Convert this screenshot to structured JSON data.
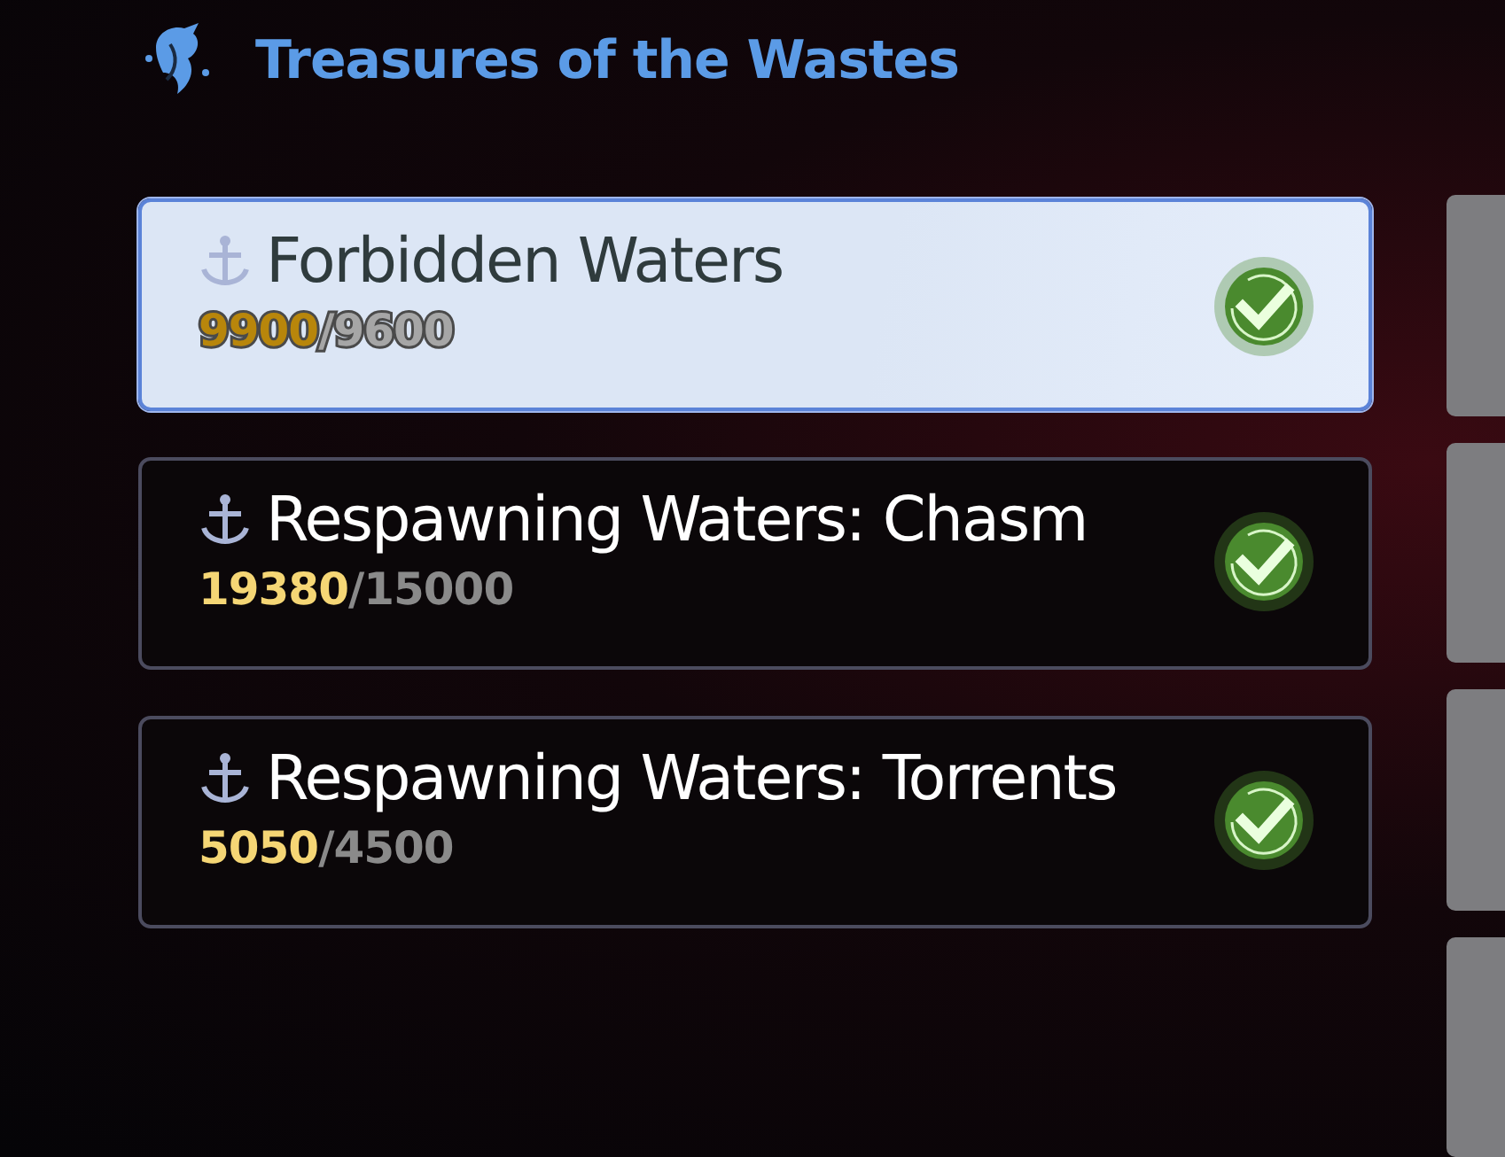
{
  "header": {
    "title": "Treasures of the Wastes"
  },
  "quests": [
    {
      "name": "Forbidden Waters",
      "current": "9900",
      "separator": "/",
      "target": "9600",
      "selected": true,
      "completed": true
    },
    {
      "name": "Respawning Waters: Chasm",
      "current": "19380",
      "separator": "/",
      "target": "15000",
      "selected": false,
      "completed": true
    },
    {
      "name": "Respawning Waters: Torrents",
      "current": "5050",
      "separator": "/",
      "target": "4500",
      "selected": false,
      "completed": true
    }
  ]
}
